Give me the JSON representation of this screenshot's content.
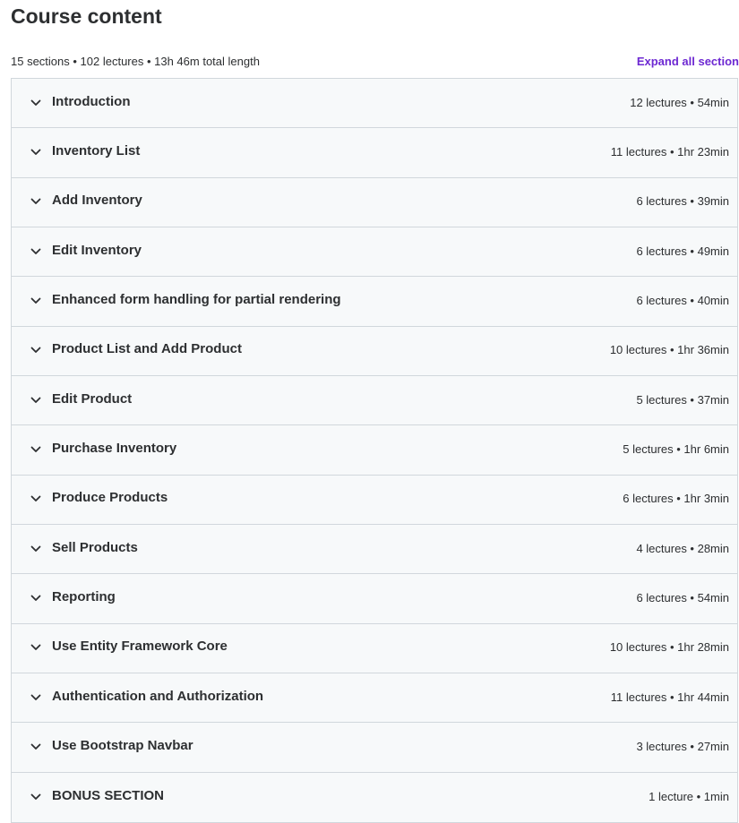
{
  "header": {
    "title": "Course content",
    "summary": "15 sections • 102 lectures • 13h 46m total length",
    "expand_all_label": "Expand all section"
  },
  "colors": {
    "accent": "#6d28d2",
    "row_bg": "#f7f9fa",
    "border": "#d1d7dc",
    "text": "#2d2f31"
  },
  "sections": [
    {
      "title": "Introduction",
      "stats": "12 lectures • 54min",
      "icon": "chevron-down-icon"
    },
    {
      "title": "Inventory List",
      "stats": "11 lectures • 1hr 23min",
      "icon": "chevron-down-icon"
    },
    {
      "title": "Add Inventory",
      "stats": "6 lectures • 39min",
      "icon": "chevron-down-icon"
    },
    {
      "title": "Edit Inventory",
      "stats": "6 lectures • 49min",
      "icon": "chevron-down-icon"
    },
    {
      "title": "Enhanced form handling for partial rendering",
      "stats": "6 lectures • 40min",
      "icon": "chevron-down-icon"
    },
    {
      "title": "Product List and Add Product",
      "stats": "10 lectures • 1hr 36min",
      "icon": "chevron-down-icon"
    },
    {
      "title": "Edit Product",
      "stats": "5 lectures • 37min",
      "icon": "chevron-down-icon"
    },
    {
      "title": "Purchase Inventory",
      "stats": "5 lectures • 1hr 6min",
      "icon": "chevron-down-icon"
    },
    {
      "title": "Produce Products",
      "stats": "6 lectures • 1hr 3min",
      "icon": "chevron-down-icon"
    },
    {
      "title": "Sell Products",
      "stats": "4 lectures • 28min",
      "icon": "chevron-down-icon"
    },
    {
      "title": "Reporting",
      "stats": "6 lectures • 54min",
      "icon": "chevron-down-icon"
    },
    {
      "title": "Use Entity Framework Core",
      "stats": "10 lectures • 1hr 28min",
      "icon": "chevron-down-icon"
    },
    {
      "title": "Authentication and Authorization",
      "stats": "11 lectures • 1hr 44min",
      "icon": "chevron-down-icon"
    },
    {
      "title": "Use Bootstrap Navbar",
      "stats": "3 lectures • 27min",
      "icon": "chevron-down-icon"
    },
    {
      "title": "BONUS SECTION",
      "stats": "1 lecture • 1min",
      "icon": "chevron-down-icon"
    }
  ]
}
